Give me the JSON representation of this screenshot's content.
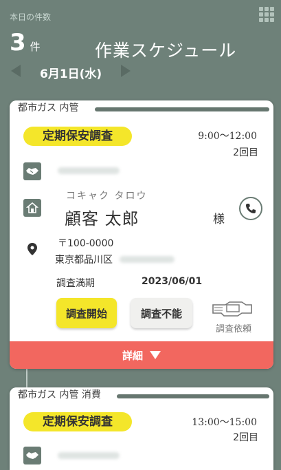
{
  "header": {
    "count_label": "本日の件数",
    "count_value": "3",
    "count_unit": "件",
    "title": "作業スケジュール",
    "date": "6月1日(水)"
  },
  "cards": [
    {
      "category": "都市ガス 内管",
      "badge": "定期保安調査",
      "time": "9:00〜12:00",
      "visit": "2回目",
      "customer_kana": "コキャク タロウ",
      "customer_name": "顧客 太郎",
      "honorific": "様",
      "postal": "〒100-0000",
      "address": "東京都品川区",
      "expiry_label": "調査満期",
      "expiry_date": "2023/06/01",
      "start_button": "調査開始",
      "unable_button": "調査不能",
      "request_label": "調査依頼",
      "detail_label": "詳細"
    },
    {
      "category": "都市ガス 内管 消費",
      "badge": "定期保安調査",
      "time": "13:00〜15:00",
      "visit": "2回目"
    }
  ],
  "icons": {
    "menu": "grid-menu-icon",
    "prev": "prev-date-icon",
    "next": "next-date-icon",
    "handshake": "handshake-icon",
    "house": "house-icon",
    "location": "location-pin-icon",
    "phone": "phone-icon",
    "request": "request-hand-icon"
  },
  "colors": {
    "background": "#6e8179",
    "badge": "#f4e62a",
    "detail_bar": "#f2675f",
    "icon": "#6a7c74"
  }
}
